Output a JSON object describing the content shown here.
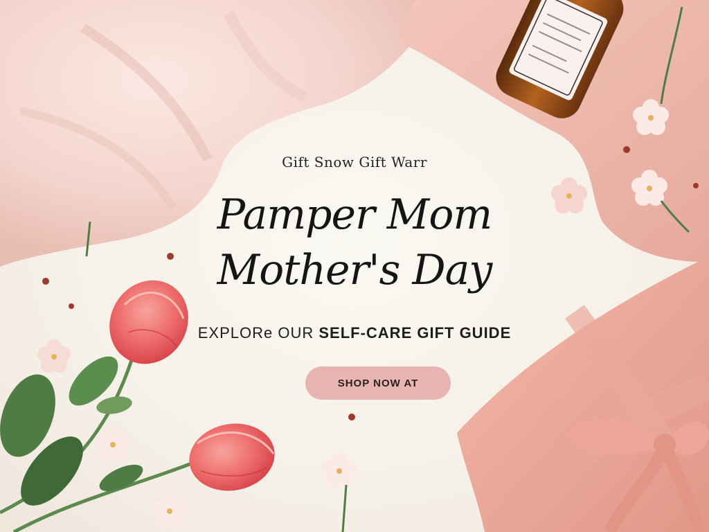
{
  "banner": {
    "eyebrow": "Gift Snow Gift Warr",
    "headline_line1": "Pamper Mom",
    "headline_line2": "Mother's Day",
    "guide_prefix": "EXPLORe OUR ",
    "guide_highlight": "SELF-CARE GIFT GUIDE",
    "cta_label": "SHOP NOW AT"
  },
  "colors": {
    "background": "#f7f3ec",
    "blanket": "#f4d6cf",
    "silk": "#eeb8ad",
    "cta": "#e7b4b2",
    "rose": "#ee6b6b",
    "leaf": "#4f7c45"
  },
  "icons": [
    "essential-oil-bottle",
    "rose",
    "flower",
    "gift-box",
    "bow"
  ]
}
